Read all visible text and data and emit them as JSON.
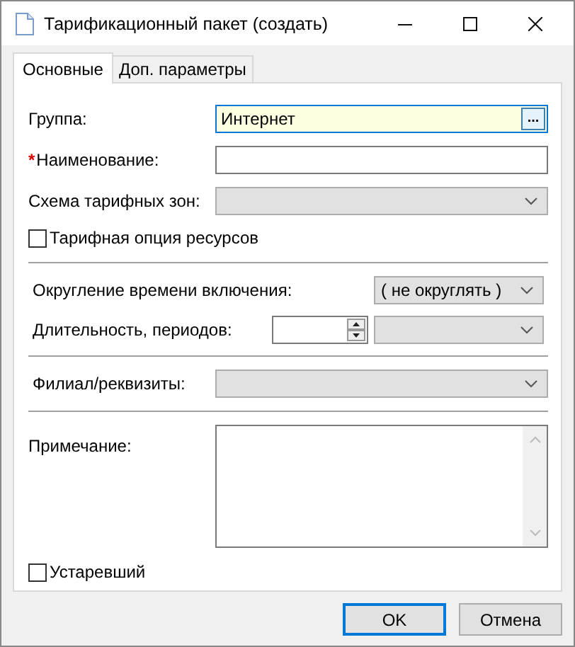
{
  "window": {
    "title": "Тарификационный пакет (создать)"
  },
  "tabs": [
    {
      "label": "Основные",
      "selected": true
    },
    {
      "label": "Доп. параметры",
      "selected": false
    }
  ],
  "group": {
    "label": "Группа:",
    "value": "Интернет",
    "button": "...",
    "focused": true
  },
  "name": {
    "label": "Наименование:",
    "marker": "*"
  },
  "zone_scheme": {
    "label": "Схема тарифных зон:"
  },
  "resource_option": {
    "label": "Тарифная опция ресурсов",
    "checked": false
  },
  "rounding": {
    "label": "Округление времени включения:",
    "value": "( не округлять )"
  },
  "duration": {
    "label": "Длительность, периодов:"
  },
  "branch": {
    "label": "Филиал/реквизиты:"
  },
  "note": {
    "label": "Примечание:"
  },
  "obsolete": {
    "label": "Устаревший",
    "checked": false
  },
  "buttons": [
    {
      "label": "OK",
      "default": true
    },
    {
      "label": "Отмена",
      "default": false
    }
  ]
}
